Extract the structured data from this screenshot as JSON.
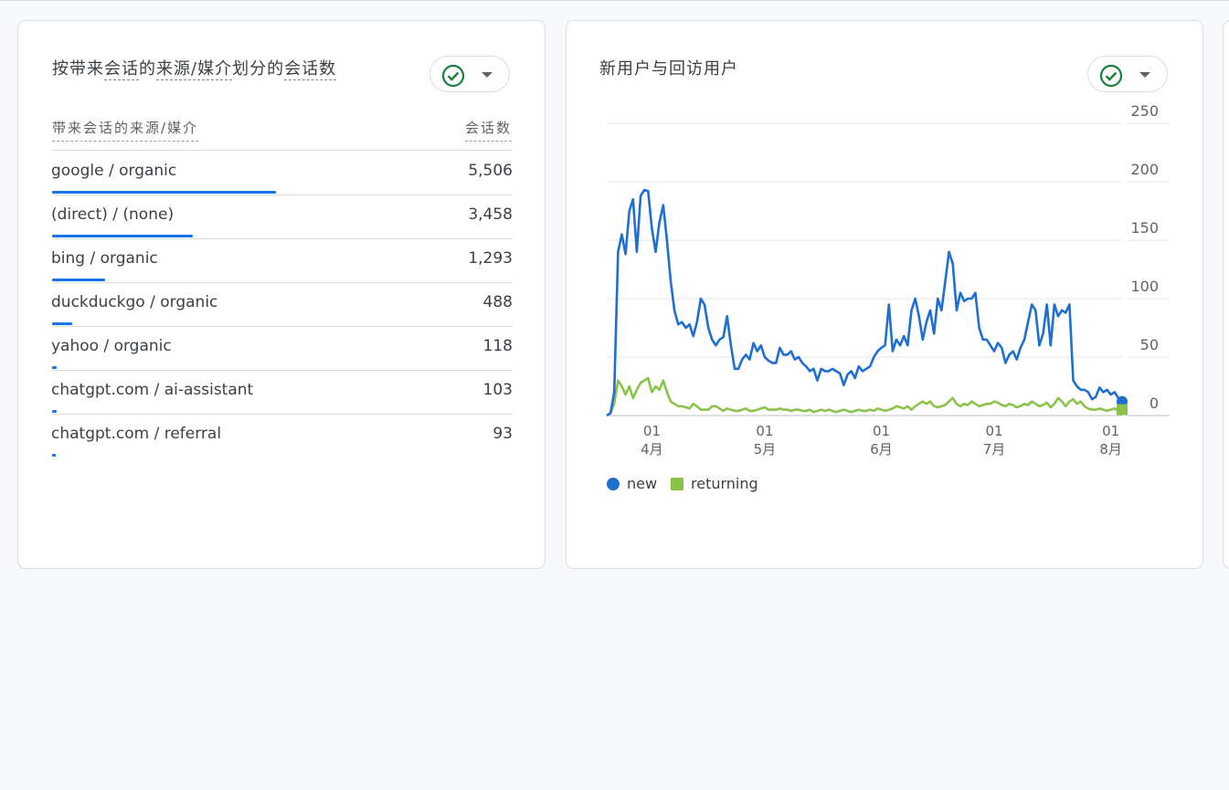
{
  "sources_card": {
    "title_parts": [
      "按带来",
      "会话",
      "的",
      "来源/媒介",
      "划分的",
      "会话数"
    ],
    "col_dimension": "带来会话的来源/媒介",
    "col_metric": "会话数",
    "rows": [
      {
        "label": "google / organic",
        "value": "5,506",
        "sessions": 5506
      },
      {
        "label": "(direct) / (none)",
        "value": "3,458",
        "sessions": 3458
      },
      {
        "label": "bing / organic",
        "value": "1,293",
        "sessions": 1293
      },
      {
        "label": "duckduckgo / organic",
        "value": "488",
        "sessions": 488
      },
      {
        "label": "yahoo / organic",
        "value": "118",
        "sessions": 118
      },
      {
        "label": "chatgpt.com / ai-assistant",
        "value": "103",
        "sessions": 103
      },
      {
        "label": "chatgpt.com / referral",
        "value": "93",
        "sessions": 93
      }
    ]
  },
  "users_card": {
    "title": "新用户与回访用户"
  },
  "icons": {
    "status": "check-circle-icon",
    "menu": "dropdown-caret-icon"
  },
  "colors": {
    "accent": "#1a73e8",
    "check": "#188038",
    "new_series": "#1f6fd1",
    "returning_series": "#8bc34a"
  },
  "chart_data": {
    "type": "line",
    "xlabel": "",
    "ylabel": "",
    "ylim": [
      0,
      250
    ],
    "y_ticks": [
      "250",
      "200",
      "150",
      "100",
      "50",
      "0"
    ],
    "y_tick_values": [
      250,
      200,
      150,
      100,
      50,
      0
    ],
    "x_ticks": [
      {
        "day": "01",
        "month": "4月",
        "date": "04-01"
      },
      {
        "day": "01",
        "month": "5月",
        "date": "05-01"
      },
      {
        "day": "01",
        "month": "6月",
        "date": "06-01"
      },
      {
        "day": "01",
        "month": "7月",
        "date": "07-01"
      },
      {
        "day": "01",
        "month": "8月",
        "date": "08-01"
      }
    ],
    "x_start": "03-20",
    "x_end": "08-04",
    "grid": true,
    "legend_position": "bottom-left",
    "series": [
      {
        "name": "new",
        "color": "#1f6fd1",
        "values": [
          0,
          2,
          20,
          140,
          155,
          138,
          175,
          185,
          140,
          188,
          193,
          192,
          160,
          140,
          165,
          180,
          150,
          115,
          90,
          78,
          80,
          75,
          78,
          68,
          80,
          100,
          95,
          75,
          65,
          60,
          65,
          67,
          85,
          60,
          40,
          40,
          48,
          52,
          48,
          62,
          55,
          60,
          50,
          47,
          45,
          45,
          58,
          52,
          52,
          55,
          48,
          50,
          45,
          42,
          38,
          40,
          30,
          40,
          38,
          38,
          40,
          38,
          36,
          26,
          35,
          38,
          32,
          42,
          38,
          40,
          42,
          50,
          55,
          58,
          60,
          95,
          55,
          65,
          60,
          68,
          60,
          90,
          100,
          85,
          65,
          80,
          90,
          70,
          100,
          90,
          115,
          140,
          130,
          90,
          105,
          98,
          100,
          100,
          105,
          75,
          65,
          65,
          60,
          55,
          62,
          58,
          45,
          52,
          55,
          48,
          58,
          65,
          80,
          95,
          90,
          60,
          70,
          95,
          60,
          95,
          85,
          90,
          88,
          95,
          30,
          25,
          22,
          22,
          20,
          14,
          16,
          24,
          20,
          22,
          18,
          20,
          15,
          12
        ]
      },
      {
        "name": "returning",
        "color": "#8bc34a",
        "values": [
          0,
          2,
          10,
          30,
          25,
          18,
          25,
          15,
          22,
          28,
          30,
          32,
          20,
          25,
          22,
          30,
          20,
          12,
          10,
          8,
          8,
          7,
          6,
          10,
          8,
          5,
          5,
          5,
          8,
          8,
          6,
          4,
          6,
          5,
          4,
          4,
          5,
          6,
          4,
          4,
          5,
          6,
          7,
          5,
          5,
          5,
          6,
          5,
          5,
          4,
          5,
          5,
          4,
          4,
          5,
          3,
          4,
          5,
          4,
          5,
          4,
          3,
          4,
          5,
          4,
          3,
          4,
          5,
          4,
          4,
          5,
          4,
          6,
          5,
          4,
          5,
          6,
          8,
          7,
          6,
          8,
          5,
          8,
          10,
          12,
          10,
          12,
          8,
          7,
          8,
          9,
          12,
          15,
          10,
          8,
          10,
          9,
          12,
          10,
          8,
          9,
          10,
          10,
          12,
          11,
          9,
          8,
          10,
          9,
          7,
          8,
          10,
          9,
          12,
          10,
          8,
          9,
          11,
          7,
          10,
          15,
          12,
          8,
          12,
          14,
          10,
          12,
          8,
          6,
          5,
          5,
          6,
          5,
          4,
          5,
          6,
          4,
          5
        ]
      }
    ]
  }
}
